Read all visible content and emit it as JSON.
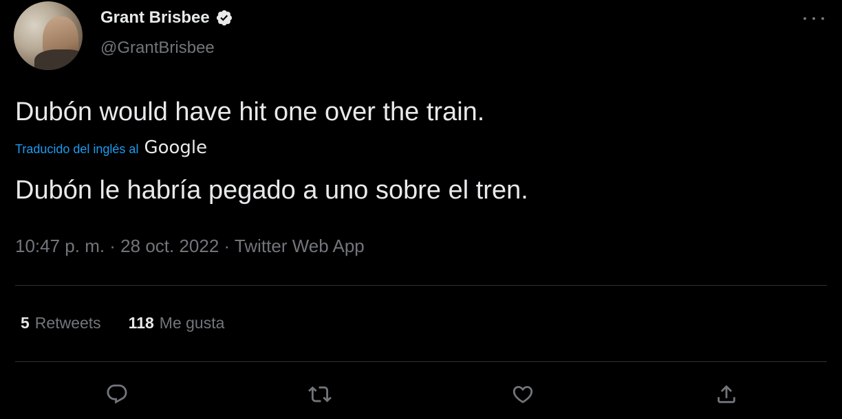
{
  "author": {
    "display_name": "Grant Brisbee",
    "handle": "@GrantBrisbee",
    "verified": true
  },
  "tweet": {
    "text": "Dubón would have hit one over the train.",
    "translation_label": "Traducido del inglés al",
    "translation_provider": "Google",
    "translated_text": "Dubón le habría pegado a uno sobre el tren.",
    "meta": "10:47 p. m. · 28 oct. 2022 · Twitter Web App"
  },
  "stats": {
    "retweets_count": "5",
    "retweets_label": "Retweets",
    "likes_count": "118",
    "likes_label": "Me gusta"
  },
  "actions": [
    {
      "name": "reply",
      "icon": "reply-icon"
    },
    {
      "name": "retweet",
      "icon": "retweet-icon"
    },
    {
      "name": "like",
      "icon": "heart-icon"
    },
    {
      "name": "share",
      "icon": "share-icon"
    }
  ],
  "colors": {
    "background": "#000000",
    "text_primary": "#e7e9ea",
    "text_secondary": "#71767b",
    "link": "#1d9bf0",
    "divider": "#2f3336"
  }
}
